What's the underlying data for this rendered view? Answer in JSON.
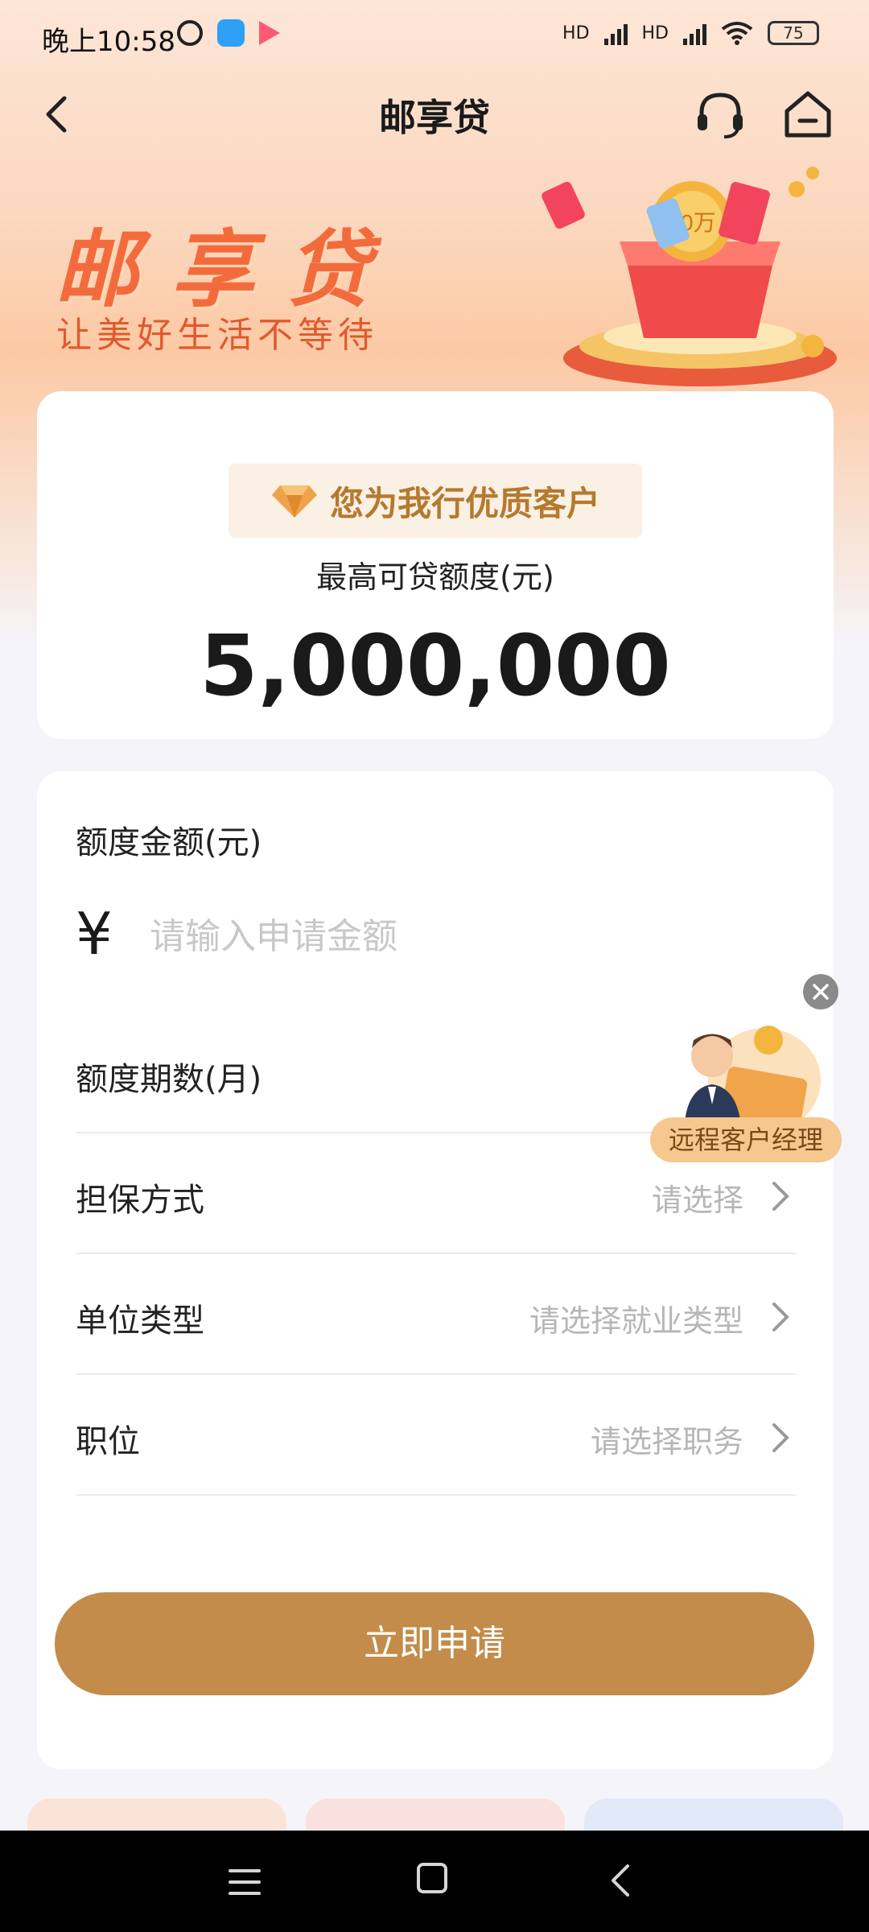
{
  "status_bar": {
    "time": "晚上10:58",
    "hd1": "HD",
    "hd2": "HD",
    "battery": "75"
  },
  "nav": {
    "title": "邮享贷"
  },
  "banner": {
    "title": "邮享贷",
    "subtitle": "让美好生活不等待",
    "art_text": "20万"
  },
  "limit_card": {
    "badge": "您为我行优质客户",
    "label": "最高可贷额度(元)",
    "value": "5,000,000"
  },
  "form": {
    "amount_label": "额度金额(元)",
    "currency_symbol": "¥",
    "amount_placeholder": "请输入申请金额",
    "rows": [
      {
        "label": "额度期数(月)",
        "value": ""
      },
      {
        "label": "担保方式",
        "value": "请选择"
      },
      {
        "label": "单位类型",
        "value": "请选择就业类型"
      },
      {
        "label": "职位",
        "value": "请选择职务"
      }
    ],
    "submit_label": "立即申请"
  },
  "floating_manager": {
    "label": "远程客户经理"
  },
  "colors": {
    "accent": "#c38c4a",
    "banner_red": "#f36b3d",
    "placeholder": "#c8c8c8"
  },
  "icons": [
    "back-icon",
    "headset-icon",
    "home-icon",
    "diamond-icon",
    "chevron-right-icon",
    "close-icon",
    "menu-icon"
  ]
}
